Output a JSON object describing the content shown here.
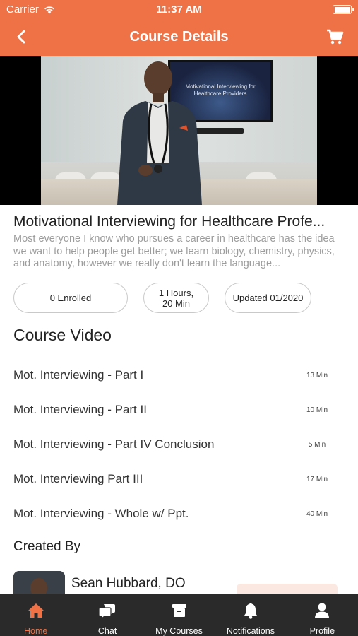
{
  "status_bar": {
    "carrier": "Carrier",
    "time": "11:37 AM"
  },
  "header": {
    "title": "Course Details",
    "back_icon": "chevron-left-icon",
    "cart_icon": "cart-icon"
  },
  "video": {
    "screen_caption": "Motivational Interviewing for Healthcare Providers"
  },
  "course": {
    "title": "Motivational Interviewing for Healthcare Profe...",
    "description": "Most everyone I know who pursues a career in healthcare has the idea we want to help people get better; we learn biology, chemistry, physics, and anatomy, however we really don't learn the language..."
  },
  "stats": {
    "enrolled": "0 Enrolled",
    "duration_line1": "1 Hours,",
    "duration_line2": "20 Min",
    "updated": "Updated 01/2020"
  },
  "course_video": {
    "heading": "Course Video",
    "items": [
      {
        "name": "Mot. Interviewing - Part I",
        "duration": "13 Min"
      },
      {
        "name": "Mot. Interviewing - Part II",
        "duration": "10 Min"
      },
      {
        "name": "Mot. Interviewing - Part IV Conclusion",
        "duration": "5 Min"
      },
      {
        "name": "Mot. Interviewing Part III",
        "duration": "17 Min"
      },
      {
        "name": "Mot. Interviewing - Whole w/ Ppt.",
        "duration": "40 Min"
      }
    ]
  },
  "created_by": {
    "heading": "Created By",
    "author_name": "Sean Hubbard, DO"
  },
  "tabbar": {
    "items": [
      {
        "label": "Home",
        "icon": "home-icon",
        "active": true
      },
      {
        "label": "Chat",
        "icon": "chat-icon",
        "active": false
      },
      {
        "label": "My Courses",
        "icon": "archive-icon",
        "active": false
      },
      {
        "label": "Notifications",
        "icon": "bell-icon",
        "active": false
      },
      {
        "label": "Profile",
        "icon": "user-icon",
        "active": false
      }
    ]
  },
  "colors": {
    "brand": "#ee7246",
    "tabbar_bg": "#2a2a2a",
    "muted_text": "#9c9c9c"
  }
}
